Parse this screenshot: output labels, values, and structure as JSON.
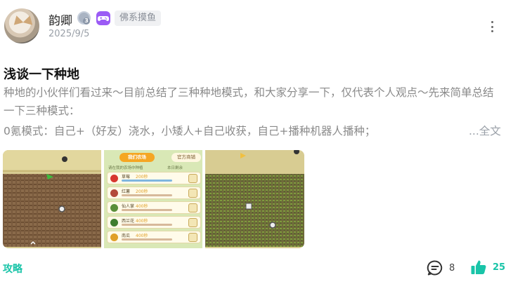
{
  "post": {
    "username": "韵卿",
    "level_badge": "3",
    "tag": "佛系摸鱼",
    "date": "2025/9/5",
    "title": "浅谈一下种地",
    "body": "种地的小伙伴们看过来～目前总结了三种种地模式，和大家分享一下，仅代表个人观点～先来简单总结一下三种模式：",
    "line3": "0氪模式：自己+（好友）浇水，小矮人+自己收获，自己+播种机器人播种；",
    "full_text_link": "...全文"
  },
  "images": {
    "thumb2": {
      "tab_active": "我们农场",
      "tab_other": "官方商铺",
      "subtitle": "请在我的农场中种植",
      "subtitle_right": "本日剩余",
      "rows": [
        {
          "name": "草莓",
          "price": "200秒",
          "color": "#d7372f"
        },
        {
          "name": "红薯",
          "price": "200秒",
          "color": "#b34a3a"
        },
        {
          "name": "仙人掌",
          "price": "400秒",
          "color": "#5a8f3a"
        },
        {
          "name": "西兰花",
          "price": "400秒",
          "color": "#3f7e2f"
        },
        {
          "name": "南瓜",
          "price": "400秒",
          "color": "#e0a028"
        }
      ]
    }
  },
  "footer": {
    "category": "攻略",
    "comment_count": "8",
    "like_count": "25"
  },
  "colors": {
    "accent": "#19c4a8",
    "muted_text": "#8a8a8a",
    "game_badge": "#9b5bf5"
  }
}
